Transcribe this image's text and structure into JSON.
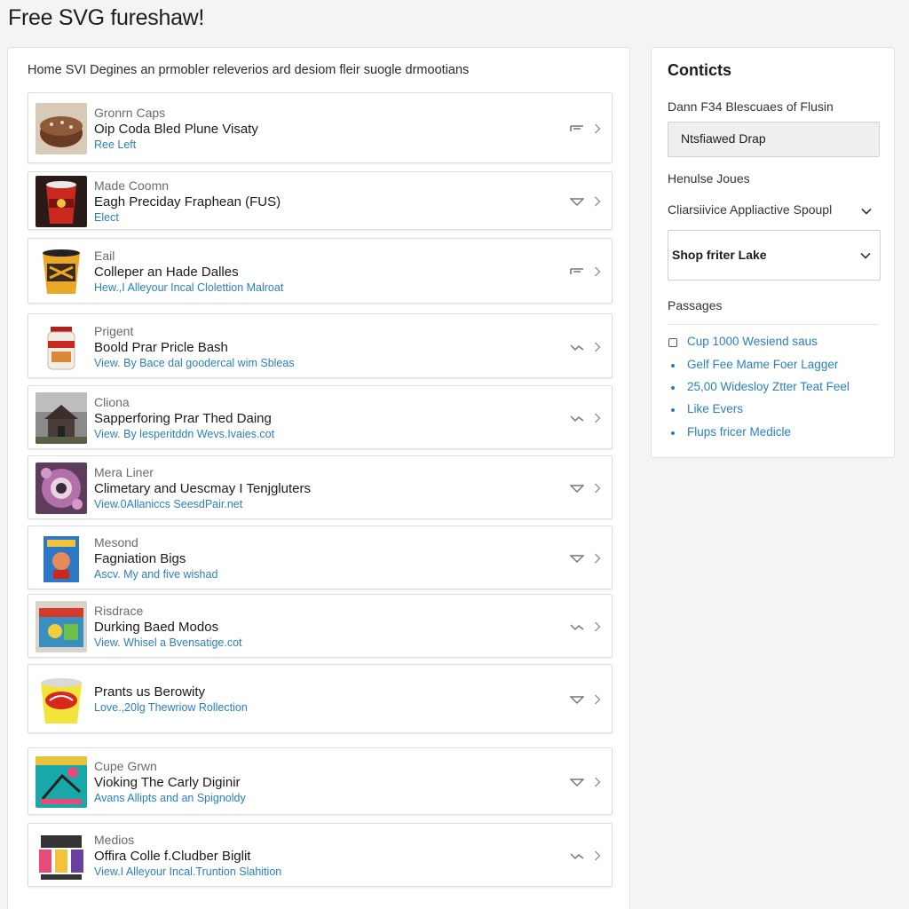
{
  "page": {
    "title": "Free SVG fureshaw!"
  },
  "main": {
    "intro": "Home SVI Degines an prmobler releverios ard desiom fleir suogle drmootians",
    "items": [
      {
        "category": "Gronrn Caps",
        "title": "Oip Coda Bled Plune Visaty",
        "link": "Ree Left",
        "icon": "flag-icon",
        "thumb": "cake"
      },
      {
        "category": "Made Coomn",
        "title": "Eagh Preciday Fraphean (FUS)",
        "link": "Elect",
        "icon": "tag-icon",
        "thumb": "cup-red"
      },
      {
        "category": "Eail",
        "title": "Colleper an Hade Dalles",
        "link": "Hew.,I Alleyour Incal Clolettion Malroat",
        "icon": "flag-icon",
        "thumb": "cup-yellow"
      },
      {
        "category": "Prigent",
        "title": "Boold Prar Pricle Bash",
        "link": "View. By Bace dal goodercal wim Sbleas",
        "icon": "share-icon",
        "thumb": "jar"
      },
      {
        "category": "Cliona",
        "title": "Sapperforing Prar Thed Daing",
        "link": "View. By lesperitddn Wevs.Ivaies.cot",
        "icon": "share-icon",
        "thumb": "house"
      },
      {
        "category": "Mera Liner",
        "title": "Climetary and Uescmay I Tenjgluters",
        "link": "View.0Allaniccs SeesdPair.net",
        "icon": "tag-icon",
        "thumb": "flower"
      },
      {
        "category": "Mesond",
        "title": "Fagniation Bigs",
        "link": "Ascv. My and five wishad",
        "icon": "tag-icon",
        "thumb": "book"
      },
      {
        "category": "Risdrace",
        "title": "Durking Baed Modos",
        "link": "View. Whisel a Bvensatige.cot",
        "icon": "share-icon",
        "thumb": "box"
      },
      {
        "category": "",
        "title": "Prants us Berowity",
        "link": "Love.,20lg Thewriow Rollection",
        "icon": "tag-icon",
        "thumb": "bucket"
      },
      {
        "category": "Cupe Grwn",
        "title": "Vioking The Carly Diginir",
        "link": "Avans Allipts and an Spignoldy",
        "icon": "tag-icon",
        "thumb": "poster"
      },
      {
        "category": "Medios",
        "title": "Offira Colle f.Cludber Biglit",
        "link": "View.I Alleyour Incal.Truntion Slahition",
        "icon": "share-icon",
        "thumb": "cards"
      }
    ]
  },
  "sidebar": {
    "heading": "Conticts",
    "subtitle": "Dann F34 Blescuaes of Flusin",
    "input_value": "Ntsfiawed Drap",
    "label1": "Henulse Joues",
    "select1": "Cliarsiivice Appliactive Spoupl",
    "select2": "Shop friter Lake",
    "label2": "Passages",
    "links": [
      {
        "label": "Cup 1000 Wesiend saus",
        "marker": "checkbox"
      },
      {
        "label": "Gelf Fee Mame Foer Lagger",
        "marker": "bullet"
      },
      {
        "label": "25,00 Widesloy Ztter Teat Feel",
        "marker": "bullet"
      },
      {
        "label": "Like Evers",
        "marker": "bullet"
      },
      {
        "label": "Flups fricer Medicle",
        "marker": "bullet"
      }
    ]
  }
}
